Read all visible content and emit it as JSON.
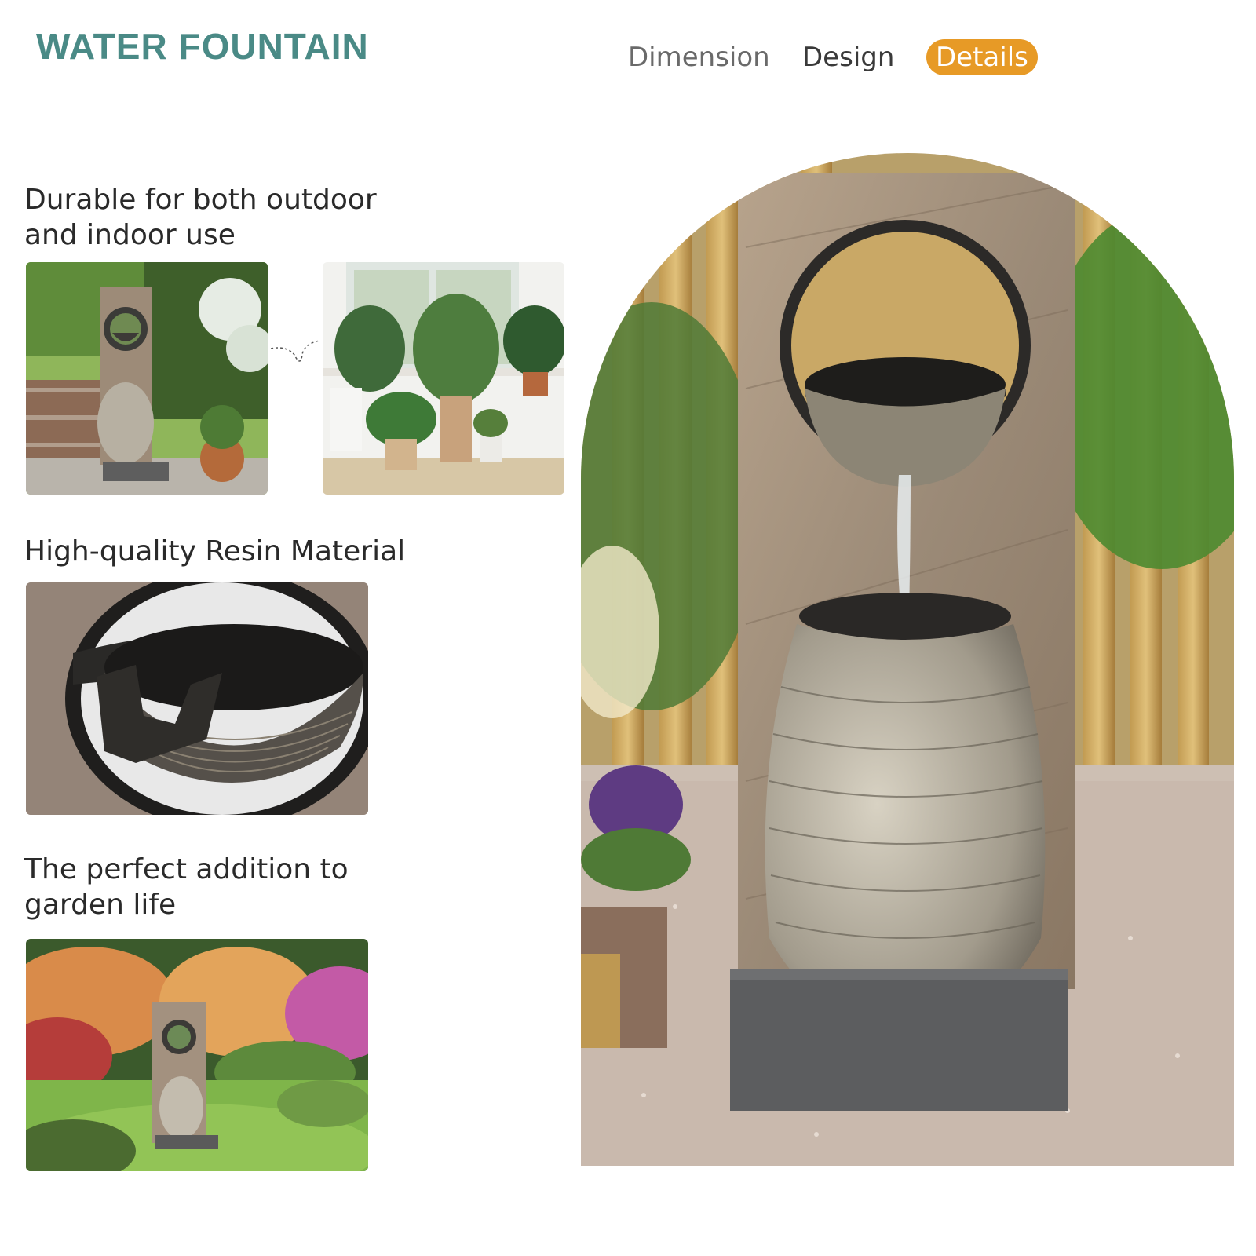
{
  "header": {
    "title": "WATER FOUNTAIN",
    "tabs": [
      {
        "label": "Dimension",
        "active": false
      },
      {
        "label": "Design",
        "active": false
      },
      {
        "label": "Details",
        "active": true
      }
    ],
    "active_color": "#e79a26",
    "title_color": "#4a8a86"
  },
  "features": [
    {
      "caption": "Durable for both outdoor\nand indoor use"
    },
    {
      "caption": "High-quality Resin Material"
    },
    {
      "caption": "The perfect addition to\ngarden life"
    }
  ]
}
